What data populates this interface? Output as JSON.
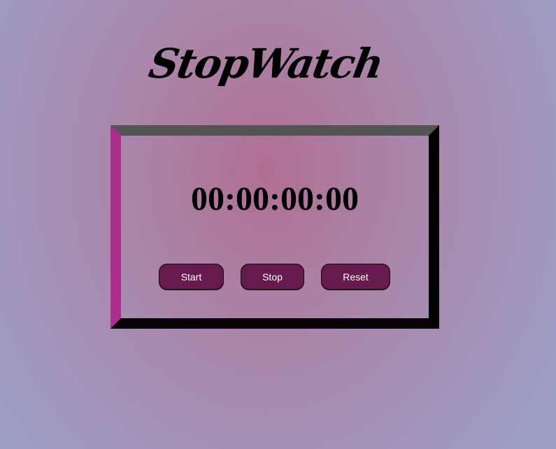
{
  "header": {
    "title": "StopWatch"
  },
  "timer": {
    "display": "00:00:00:00"
  },
  "controls": {
    "start_label": "Start",
    "stop_label": "Stop",
    "reset_label": "Reset"
  },
  "colors": {
    "button_bg": "#671a4d",
    "button_text": "#ffffff",
    "frame_dark": "#000000",
    "frame_accent": "#5e1a4c",
    "background_center": "#b06f93",
    "background_edge": "#9c9ec7"
  }
}
